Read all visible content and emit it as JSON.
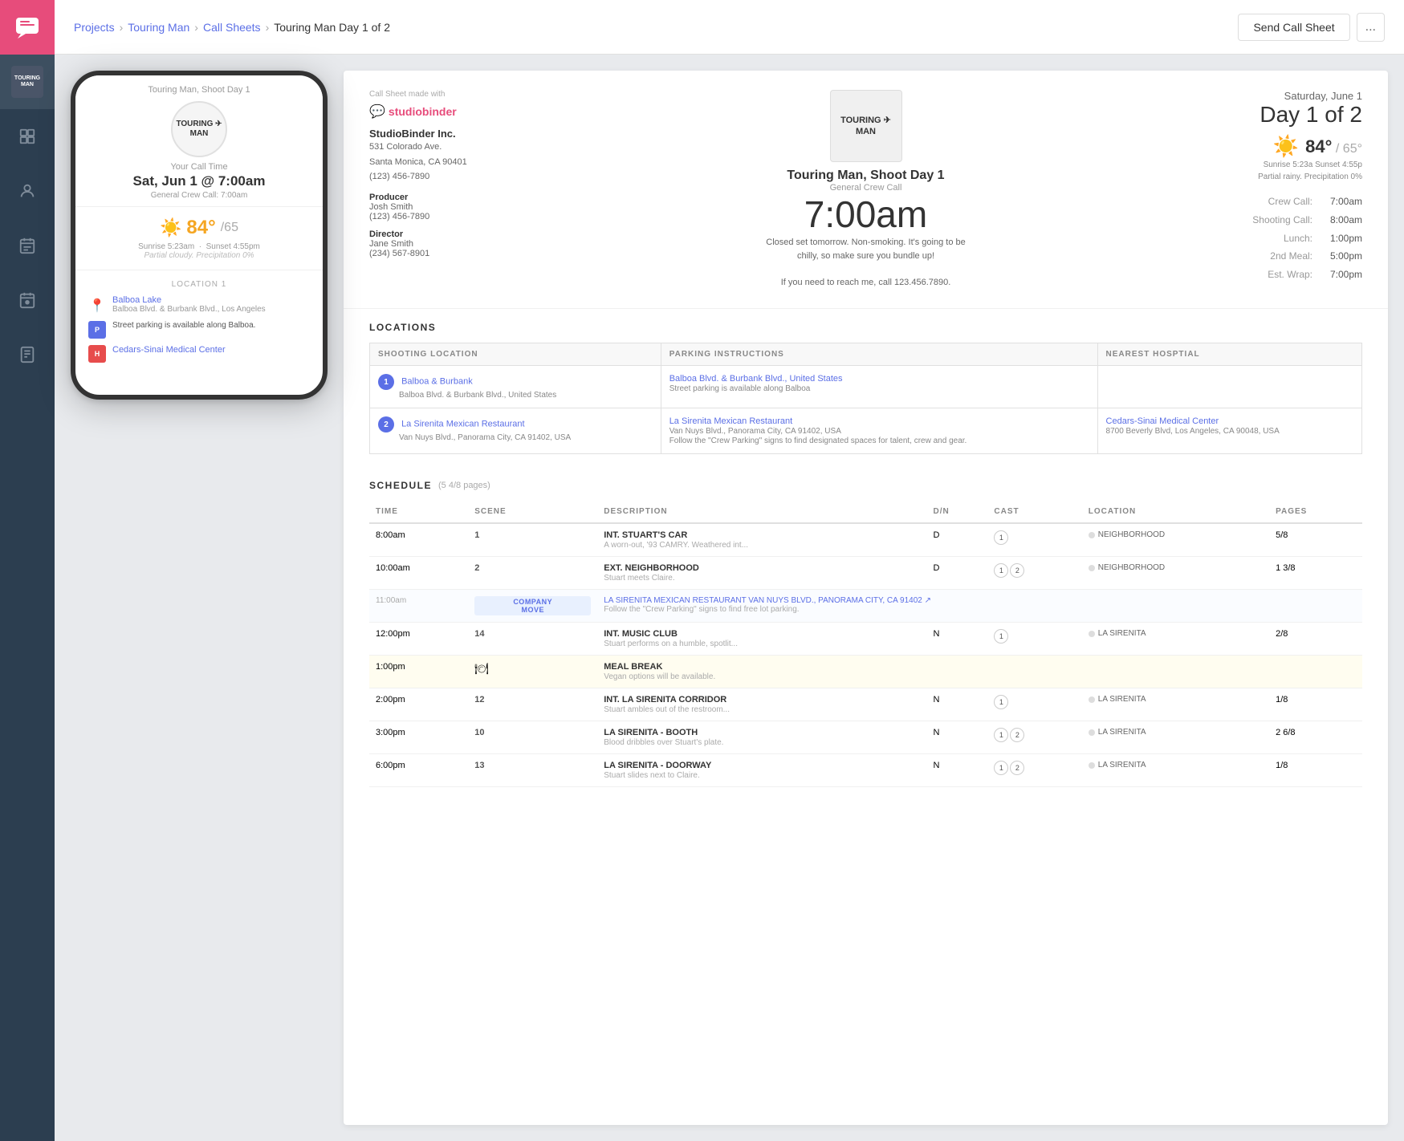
{
  "sidebar": {
    "logo_icon": "💬",
    "items": [
      {
        "id": "project",
        "label": "TOURING MAN",
        "icon": "project",
        "active": false
      },
      {
        "id": "storyboard",
        "label": "Storyboard",
        "icon": "storyboard"
      },
      {
        "id": "cast",
        "label": "Cast",
        "icon": "cast"
      },
      {
        "id": "schedule",
        "label": "Schedule",
        "icon": "schedule"
      },
      {
        "id": "calendar",
        "label": "Calendar",
        "icon": "calendar"
      },
      {
        "id": "files",
        "label": "Files",
        "icon": "files"
      }
    ]
  },
  "topbar": {
    "breadcrumbs": [
      {
        "label": "Projects",
        "link": true
      },
      {
        "label": "Touring Man",
        "link": true
      },
      {
        "label": "Call Sheets",
        "link": true
      },
      {
        "label": "Touring Man Day 1 of 2",
        "link": false
      }
    ],
    "send_button": "Send Call Sheet",
    "more_button": "..."
  },
  "phone": {
    "shoot_title": "Touring Man, Shoot Day 1",
    "logo_line1": "TOURING ✈",
    "logo_line2": "MAN",
    "call_time_label": "Your Call Time",
    "call_time": "Sat, Jun 1 @ 7:00am",
    "crew_call": "General Crew Call: 7:00am",
    "weather_temp": "84°",
    "weather_low": "/65",
    "sunrise": "Sunrise 5:23am",
    "sunset": "Sunset 4:55pm",
    "weather_desc": "Partial cloudy. Precipitation 0%",
    "location_label": "LOCATION 1",
    "location_name": "Balboa Lake",
    "location_addr": "Balboa Blvd. & Burbank Blvd., Los Angeles",
    "parking_text": "Street parking is available along Balboa.",
    "hospital_name": "Cedars-Sinai Medical Center"
  },
  "callsheet": {
    "made_with": "Call Sheet made with",
    "studio_name": "studiobinder",
    "company": {
      "name": "StudioBinder Inc.",
      "address1": "531 Colorado Ave.",
      "address2": "Santa Monica, CA 90401",
      "phone": "(123) 456-7890"
    },
    "producer": {
      "role": "Producer",
      "name": "Josh Smith",
      "phone": "(123) 456-7890"
    },
    "director": {
      "role": "Director",
      "name": "Jane Smith",
      "phone": "(234) 567-8901"
    },
    "project_logo1": "TOURING ✈",
    "project_logo2": "MAN",
    "shoot_title": "Touring Man, Shoot Day 1",
    "crew_call_label": "General Crew Call",
    "call_time": "7:00am",
    "notes1": "Closed set tomorrow. Non-smoking. It's going to be",
    "notes2": "chilly, so make sure you bundle up!",
    "notes3": "",
    "contact_note": "If you need to reach me, call 123.456.7890.",
    "date": "Saturday, June 1",
    "day_header": "Day 1 of 2",
    "weather_temp": "84°",
    "weather_low": "/ 65°",
    "weather_sunrise": "Sunrise 5:23a",
    "weather_sunset": "Sunset 4:55p",
    "weather_desc": "Partial rainy. Precipitation 0%",
    "times": [
      {
        "label": "Crew Call:",
        "value": "7:00am"
      },
      {
        "label": "Shooting Call:",
        "value": "8:00am"
      },
      {
        "label": "Lunch:",
        "value": "1:00pm"
      },
      {
        "label": "2nd Meal:",
        "value": "5:00pm"
      },
      {
        "label": "Est. Wrap:",
        "value": "7:00pm"
      }
    ],
    "locations_title": "LOCATIONS",
    "locations_headers": [
      "SHOOTING LOCATION",
      "PARKING INSTRUCTIONS",
      "NEAREST HOSPTIAL"
    ],
    "locations": [
      {
        "num": "1",
        "name": "Balboa & Burbank",
        "addr": "Balboa Blvd. & Burbank Blvd., United States",
        "parking": "Balboa Blvd. & Burbank Blvd., United States",
        "parking_detail": "Street parking is available along Balboa",
        "hospital": ""
      },
      {
        "num": "2",
        "name": "La Sirenita Mexican Restaurant",
        "addr": "Van Nuys Blvd., Panorama City, CA 91402, USA",
        "parking": "La Sirenita Mexican Restaurant",
        "parking_detail_line1": "Van Nuys Blvd., Panorama City, CA 91402, USA",
        "parking_detail_line2": "Follow the \"Crew Parking\" signs to find designated spaces for talent, crew and gear.",
        "hospital_name": "Cedars-Sinai Medical Center",
        "hospital_addr": "8700 Beverly Blvd, Los Angeles, CA 90048, USA"
      }
    ],
    "schedule_title": "SCHEDULE",
    "schedule_sub": "(5 4/8 pages)",
    "schedule_headers": [
      "TIME",
      "SCENE",
      "DESCRIPTION",
      "D/N",
      "CAST",
      "LOCATION",
      "PAGES"
    ],
    "schedule_rows": [
      {
        "time": "8:00am",
        "scene": "1",
        "desc_title": "INT. STUART'S CAR",
        "desc_sub": "A worn-out, '93 CAMRY. Weathered int...",
        "dn": "D",
        "cast": [
          "1"
        ],
        "location": "NEIGHBORHOOD",
        "pages": "5/8",
        "type": "normal"
      },
      {
        "time": "10:00am",
        "scene": "2",
        "desc_title": "EXT. NEIGHBORHOOD",
        "desc_sub": "Stuart meets Claire.",
        "dn": "D",
        "cast": [
          "1",
          "2"
        ],
        "location": "NEIGHBORHOOD",
        "pages": "1 3/8",
        "type": "normal"
      },
      {
        "time": "11:00am",
        "scene": "",
        "desc_title": "LA SIRENITA MEXICAN RESTAURANT VAN NUYS BLVD., PANORAMA CITY, CA 91402 ↗",
        "desc_sub": "Follow the \"Crew Parking\" signs to find free lot parking.",
        "dn": "",
        "cast": [],
        "location": "",
        "pages": "",
        "type": "company-move"
      },
      {
        "time": "12:00pm",
        "scene": "14",
        "desc_title": "INT. MUSIC CLUB",
        "desc_sub": "Stuart performs on a humble, spotlit...",
        "dn": "N",
        "cast": [
          "1"
        ],
        "location": "LA SIRENITA",
        "pages": "2/8",
        "type": "normal"
      },
      {
        "time": "1:00pm",
        "scene": "",
        "desc_title": "MEAL BREAK",
        "desc_sub": "Vegan options will be available.",
        "dn": "",
        "cast": [],
        "location": "",
        "pages": "",
        "type": "meal-break"
      },
      {
        "time": "2:00pm",
        "scene": "12",
        "desc_title": "INT. LA SIRENITA CORRIDOR",
        "desc_sub": "Stuart ambles out of the restroom...",
        "dn": "N",
        "cast": [
          "1"
        ],
        "location": "LA SIRENITA",
        "pages": "1/8",
        "type": "normal"
      },
      {
        "time": "3:00pm",
        "scene": "10",
        "desc_title": "LA SIRENITA - BOOTH",
        "desc_sub": "Blood dribbles over Stuart's plate.",
        "dn": "N",
        "cast": [
          "1",
          "2"
        ],
        "location": "LA SIRENITA",
        "pages": "2 6/8",
        "type": "normal"
      },
      {
        "time": "6:00pm",
        "scene": "13",
        "desc_title": "LA SIRENITA - DOORWAY",
        "desc_sub": "Stuart slides next to Claire.",
        "dn": "N",
        "cast": [
          "1",
          "2"
        ],
        "location": "LA SIRENITA",
        "pages": "1/8",
        "type": "normal"
      }
    ]
  }
}
